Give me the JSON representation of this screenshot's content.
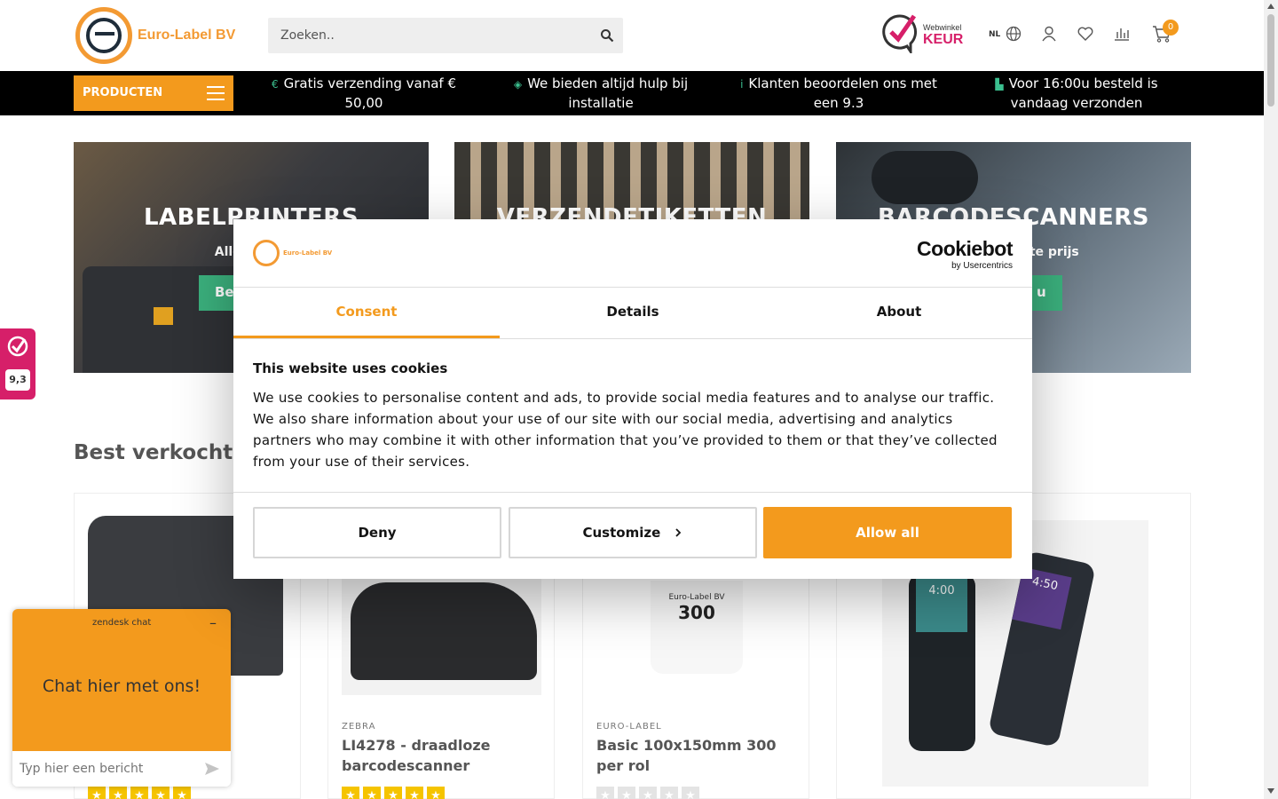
{
  "header": {
    "logo_text": "Euro-Label BV",
    "search_placeholder": "Zoeken..",
    "keur_small": "Webwinkel",
    "keur_big": "KEUR",
    "lang": "NL",
    "cart_count": "0",
    "icons": [
      "search-icon",
      "globe-icon",
      "user-icon",
      "heart-icon",
      "compare-icon",
      "cart-icon"
    ]
  },
  "nav": {
    "products_label": "PRODUCTEN",
    "usps": [
      {
        "icon": "euro-icon",
        "glyph": "€",
        "text": "Gratis verzending vanaf € 50,00"
      },
      {
        "icon": "shield-icon",
        "glyph": "◈",
        "text": "We bieden altijd hulp bij installatie"
      },
      {
        "icon": "info-icon",
        "glyph": "i",
        "text": "Klanten beoordelen ons met een 9.3"
      },
      {
        "icon": "truck-icon",
        "glyph": "▙",
        "text": "Voor 16:00u besteld is vandaag verzonden"
      }
    ]
  },
  "hero": [
    {
      "title": "LABELPRINTERS",
      "subtitle": "Alle A-mer",
      "button": "Be"
    },
    {
      "title": "VERZENDETIKETTEN",
      "subtitle": "",
      "button": ""
    },
    {
      "title": "BARCODESCANNERS",
      "subtitle": "este prijs",
      "button": "u"
    }
  ],
  "best_sellers": {
    "title": "Best verkochte",
    "products": [
      {
        "brand": "",
        "name": "",
        "rating": 5
      },
      {
        "brand": "ZEBRA",
        "name": "LI4278 - draadloze barcodescanner",
        "rating": 5
      },
      {
        "brand": "EURO-LABEL",
        "name": "Basic 100x150mm 300 per rol",
        "rating": 0
      },
      {
        "brand": "",
        "name": "",
        "rating": 0
      }
    ],
    "roll_label": "300",
    "roll_brand": "Euro-Label BV",
    "scanner_time1": "4:00",
    "scanner_time2": "4:50"
  },
  "side_badge": {
    "score": "9,3"
  },
  "chat": {
    "brand": "zendesk chat",
    "minimize": "–",
    "heading": "Chat hier met ons!",
    "input_placeholder": "Typ hier een bericht"
  },
  "cookie": {
    "logo_text": "Euro-Label BV",
    "brand_big": "Cookiebot",
    "brand_small": "by Usercentrics",
    "tabs": [
      "Consent",
      "Details",
      "About"
    ],
    "heading": "This website uses cookies",
    "body": "We use cookies to personalise content and ads, to provide social media features and to analyse our traffic. We also share information about your use of our site with our social media, advertising and analytics partners who may combine it with other information that you’ve provided to them or that they’ve collected from your use of their services.",
    "buttons": {
      "deny": "Deny",
      "customize": "Customize",
      "allow": "Allow all"
    }
  },
  "colors": {
    "accent": "#f39a1d",
    "green": "#3bb07d",
    "pink": "#d61f69",
    "black": "#000000"
  }
}
